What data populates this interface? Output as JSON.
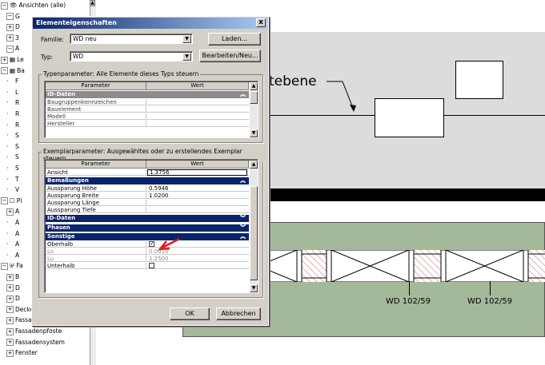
{
  "tree": {
    "items": [
      {
        "box": "⊟",
        "icon": "👁",
        "label": "Ansichten (alle)",
        "indent": 0
      },
      {
        "box": "⊟",
        "label": "G",
        "indent": 1
      },
      {
        "box": "⊞",
        "label": "D",
        "indent": 1
      },
      {
        "box": "⊞",
        "label": "3",
        "indent": 1
      },
      {
        "box": "⊟",
        "label": "A",
        "indent": 1
      },
      {
        "box": "⊞",
        "icon": "▦",
        "label": "Le",
        "indent": 0
      },
      {
        "box": "⊟",
        "icon": "▦",
        "label": "Ba",
        "indent": 0
      },
      {
        "box": "",
        "label": "F",
        "indent": 1
      },
      {
        "box": "",
        "label": "L",
        "indent": 1
      },
      {
        "box": "",
        "label": "R",
        "indent": 1
      },
      {
        "box": "",
        "label": "R",
        "indent": 1
      },
      {
        "box": "",
        "label": "R",
        "indent": 1
      },
      {
        "box": "",
        "label": "S",
        "indent": 1
      },
      {
        "box": "",
        "label": "S",
        "indent": 1
      },
      {
        "box": "",
        "label": "S",
        "indent": 1
      },
      {
        "box": "",
        "label": "S",
        "indent": 1
      },
      {
        "box": "",
        "label": "T",
        "indent": 1
      },
      {
        "box": "",
        "label": "V",
        "indent": 1
      },
      {
        "box": "⊟",
        "icon": "☐",
        "label": "Pl",
        "indent": 0
      },
      {
        "box": "⊞",
        "label": "A",
        "indent": 1
      },
      {
        "box": "",
        "label": "A",
        "indent": 1
      },
      {
        "box": "",
        "label": "A",
        "indent": 1
      },
      {
        "box": "",
        "label": "A",
        "indent": 1
      },
      {
        "box": "",
        "label": "A",
        "indent": 1
      },
      {
        "box": "⊟",
        "icon": "⊮",
        "label": "Fa",
        "indent": 0
      },
      {
        "box": "⊞",
        "label": "B",
        "indent": 1
      },
      {
        "box": "⊞",
        "label": "D",
        "indent": 1
      },
      {
        "box": "⊞",
        "label": "D",
        "indent": 1
      },
      {
        "box": "⊞",
        "label": "Decke",
        "indent": 1
      },
      {
        "box": "⊞",
        "label": "Fassadenelemer",
        "indent": 1
      },
      {
        "box": "⊞",
        "label": "Fassadenpfoste",
        "indent": 1
      },
      {
        "box": "⊞",
        "label": "Fassadensystem",
        "indent": 1
      },
      {
        "box": "⊞",
        "label": "Fenster",
        "indent": 1
      }
    ]
  },
  "canvas": {
    "level_label": "tebene",
    "tags": [
      "WD 102/59",
      "WD 102/59"
    ]
  },
  "dialog": {
    "title": "Elementeigenschaften",
    "close_glyph": "x",
    "family_label": "Familie:",
    "family_value": "WD neu",
    "type_label": "Typ:",
    "type_value": "WD",
    "load_button": "Laden...",
    "edit_button": "Bearbeiten/Neu...",
    "type_params": {
      "group_title": "Typenparameter: Alle Elemente dieses Typs steuern",
      "col_param": "Parameter",
      "col_value": "Wert",
      "section": "ID-Daten",
      "rows": [
        "Baugruppenkennzeichen",
        "Bauelement",
        "Modell",
        "Hersteller"
      ]
    },
    "instance_params": {
      "group_title": "Exemplarparameter: Ausgewähltes oder zu erstellendes Exemplar steuern",
      "col_param": "Parameter",
      "col_value": "Wert",
      "ansicht_label": "Ansicht",
      "ansicht_value": "1.3756",
      "sec_dimensions": "Bemaßungen",
      "dim_rows": [
        {
          "label": "Aussparung Höhe",
          "value": "0.5946"
        },
        {
          "label": "Aussparung Breite",
          "value": "1.0200"
        },
        {
          "label": "Aussparung Länge",
          "value": ""
        },
        {
          "label": "Aussparung Tiefe",
          "value": ""
        }
      ],
      "sec_id": "ID-Daten",
      "sec_phases": "Phasen",
      "sec_other": "Sonstige",
      "other_rows": [
        {
          "label": "Oberhalb",
          "value": "",
          "check": true
        },
        {
          "label": "Lo",
          "value": "0.0010",
          "check": false,
          "gray": true
        },
        {
          "label": "Lu",
          "value": "1.2500",
          "check": false,
          "gray": true
        },
        {
          "label": "Unterhalb",
          "value": "",
          "check": true
        }
      ]
    },
    "ok_button": "OK",
    "cancel_button": "Abbrechen"
  },
  "colors": {
    "title_bar": "#0a246a",
    "section_header": "#0a246a",
    "canvas_green": "#a4b89a",
    "annotation_red": "#e81818"
  }
}
